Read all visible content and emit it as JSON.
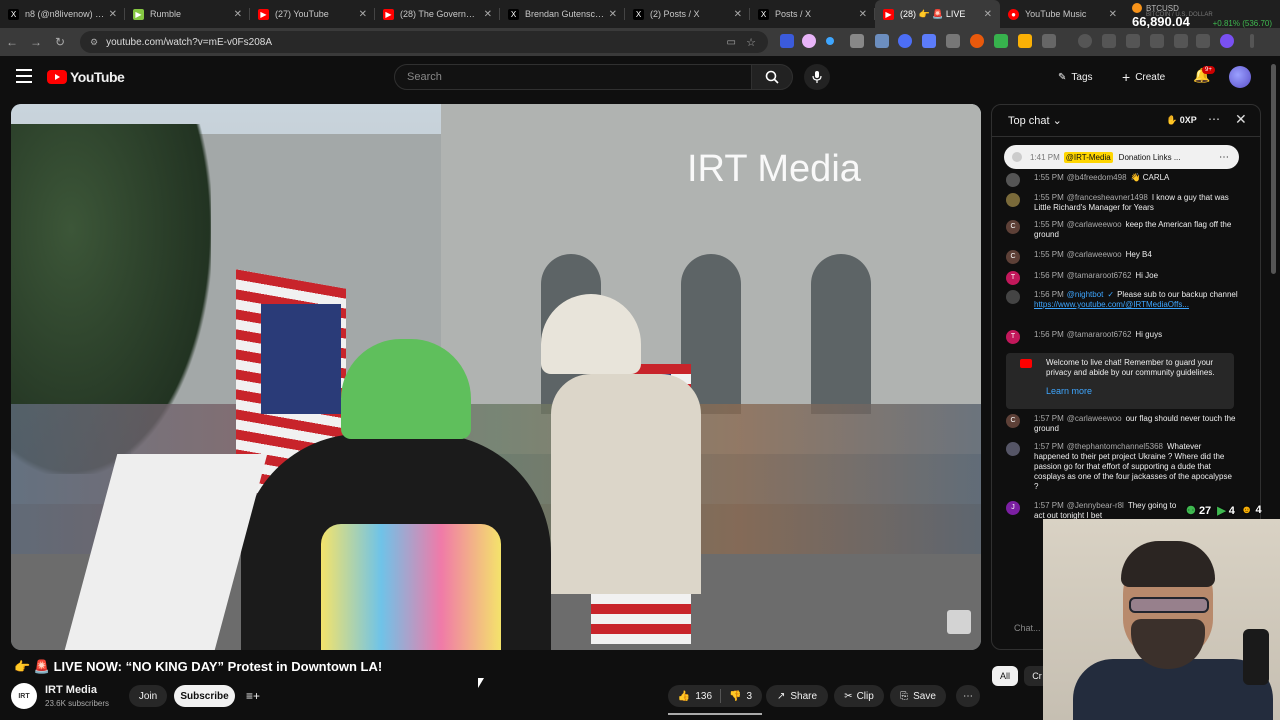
{
  "browser": {
    "tabs": [
      {
        "title": "n8 (@n8livenow) / X",
        "icon": "x-icon",
        "color": "#000000"
      },
      {
        "title": "Rumble",
        "icon": "rumble-icon",
        "color": "#85c742"
      },
      {
        "title": "(27) YouTube",
        "icon": "youtube-icon",
        "color": "#ff0000"
      },
      {
        "title": "(28) The Government'",
        "icon": "youtube-icon",
        "color": "#ff0000"
      },
      {
        "title": "Brendan Gutenschwag",
        "icon": "x-icon",
        "color": "#000000"
      },
      {
        "title": "(2) Posts / X",
        "icon": "x-icon",
        "color": "#000000"
      },
      {
        "title": "Posts / X",
        "icon": "x-icon",
        "color": "#000000"
      },
      {
        "title": "(28) 👉 🚨 LIVE",
        "icon": "youtube-icon",
        "color": "#ff0000"
      },
      {
        "title": "YouTube Music",
        "icon": "youtube-music-icon",
        "color": "#ff0000"
      }
    ],
    "ticker": {
      "symbol": "BTCUSD",
      "subtitle": "BITCOIN / U.S. DOLLAR",
      "price": "66,890.04",
      "change": "+0.81% (536.70)"
    },
    "url": "youtube.com/watch?v=mE-v0Fs208A"
  },
  "yt": {
    "logo_text": "YouTube",
    "search_placeholder": "Search",
    "tags_label": "Tags",
    "create_label": "Create",
    "notification_badge": "9+"
  },
  "video": {
    "watermark": "IRT Media",
    "title": "👉 🚨 LIVE NOW: “NO KING DAY” Protest in Downtown LA!",
    "channel_name": "IRT Media",
    "channel_avatar_text": "IRT",
    "subscribers": "23.6K subscribers",
    "join_label": "Join",
    "subscribe_label": "Subscribe",
    "likes": "136",
    "dislikes": "3",
    "share_label": "Share",
    "clip_label": "Clip",
    "save_label": "Save"
  },
  "chat": {
    "mode": "Top chat",
    "xp": "0XP",
    "pinned": {
      "time": "1:41 PM",
      "author": "@IRT-Media",
      "text": "Donation Links ..."
    },
    "messages": [
      {
        "time": "1:55 PM",
        "author": "@b4freedom498",
        "text": "👋 CARLA",
        "avatar": "",
        "color": "#555"
      },
      {
        "time": "1:55 PM",
        "author": "@francesheavner1498",
        "text": "I know a guy that was Little Richard's Manager for Years",
        "avatar": "",
        "color": "#7a6a3a"
      },
      {
        "time": "1:55 PM",
        "author": "@carlaweewoo",
        "text": "keep the American flag off the ground",
        "avatar": "C",
        "color": "#5d4037"
      },
      {
        "time": "1:55 PM",
        "author": "@carlaweewoo",
        "text": "Hey B4",
        "avatar": "C",
        "color": "#5d4037"
      },
      {
        "time": "1:56 PM",
        "author": "@tamararoot6762",
        "text": "Hi Joe",
        "avatar": "T",
        "color": "#c2185b"
      },
      {
        "time": "1:56 PM",
        "author": "@nightbot",
        "text": "Please sub to our backup channel",
        "link": "https://www.youtube.com/@IRTMediaOffs...",
        "avatar": "",
        "color": "#444"
      },
      {
        "time": "1:56 PM",
        "author": "@tamararoot6762",
        "text": "Hi guys",
        "avatar": "T",
        "color": "#c2185b"
      },
      {
        "time": "1:57 PM",
        "author": "@carlaweewoo",
        "text": "our flag should never touch the ground",
        "avatar": "C",
        "color": "#5d4037"
      },
      {
        "time": "1:57 PM",
        "author": "@thephantomchannel5368",
        "text": "Whatever happened to their pet project Ukraine ? Where did the passion go for that effort of supporting a dude that cosplays as one of the four jackasses of the apocalypse ?",
        "avatar": "",
        "color": "#556"
      },
      {
        "time": "1:57 PM",
        "author": "@Jennybear-r8l",
        "text": "They going to act out tonight I bet",
        "avatar": "J",
        "color": "#7b1fa2"
      }
    ],
    "welcome": "Welcome to live chat! Remember to guard your privacy and abide by our community guidelines.",
    "learn_more": "Learn more",
    "input_placeholder": "Chat...",
    "chip_all": "All",
    "chip_cr": "Cr"
  },
  "overlay": {
    "stat1": "27",
    "stat2": "4",
    "stat3": "4"
  }
}
